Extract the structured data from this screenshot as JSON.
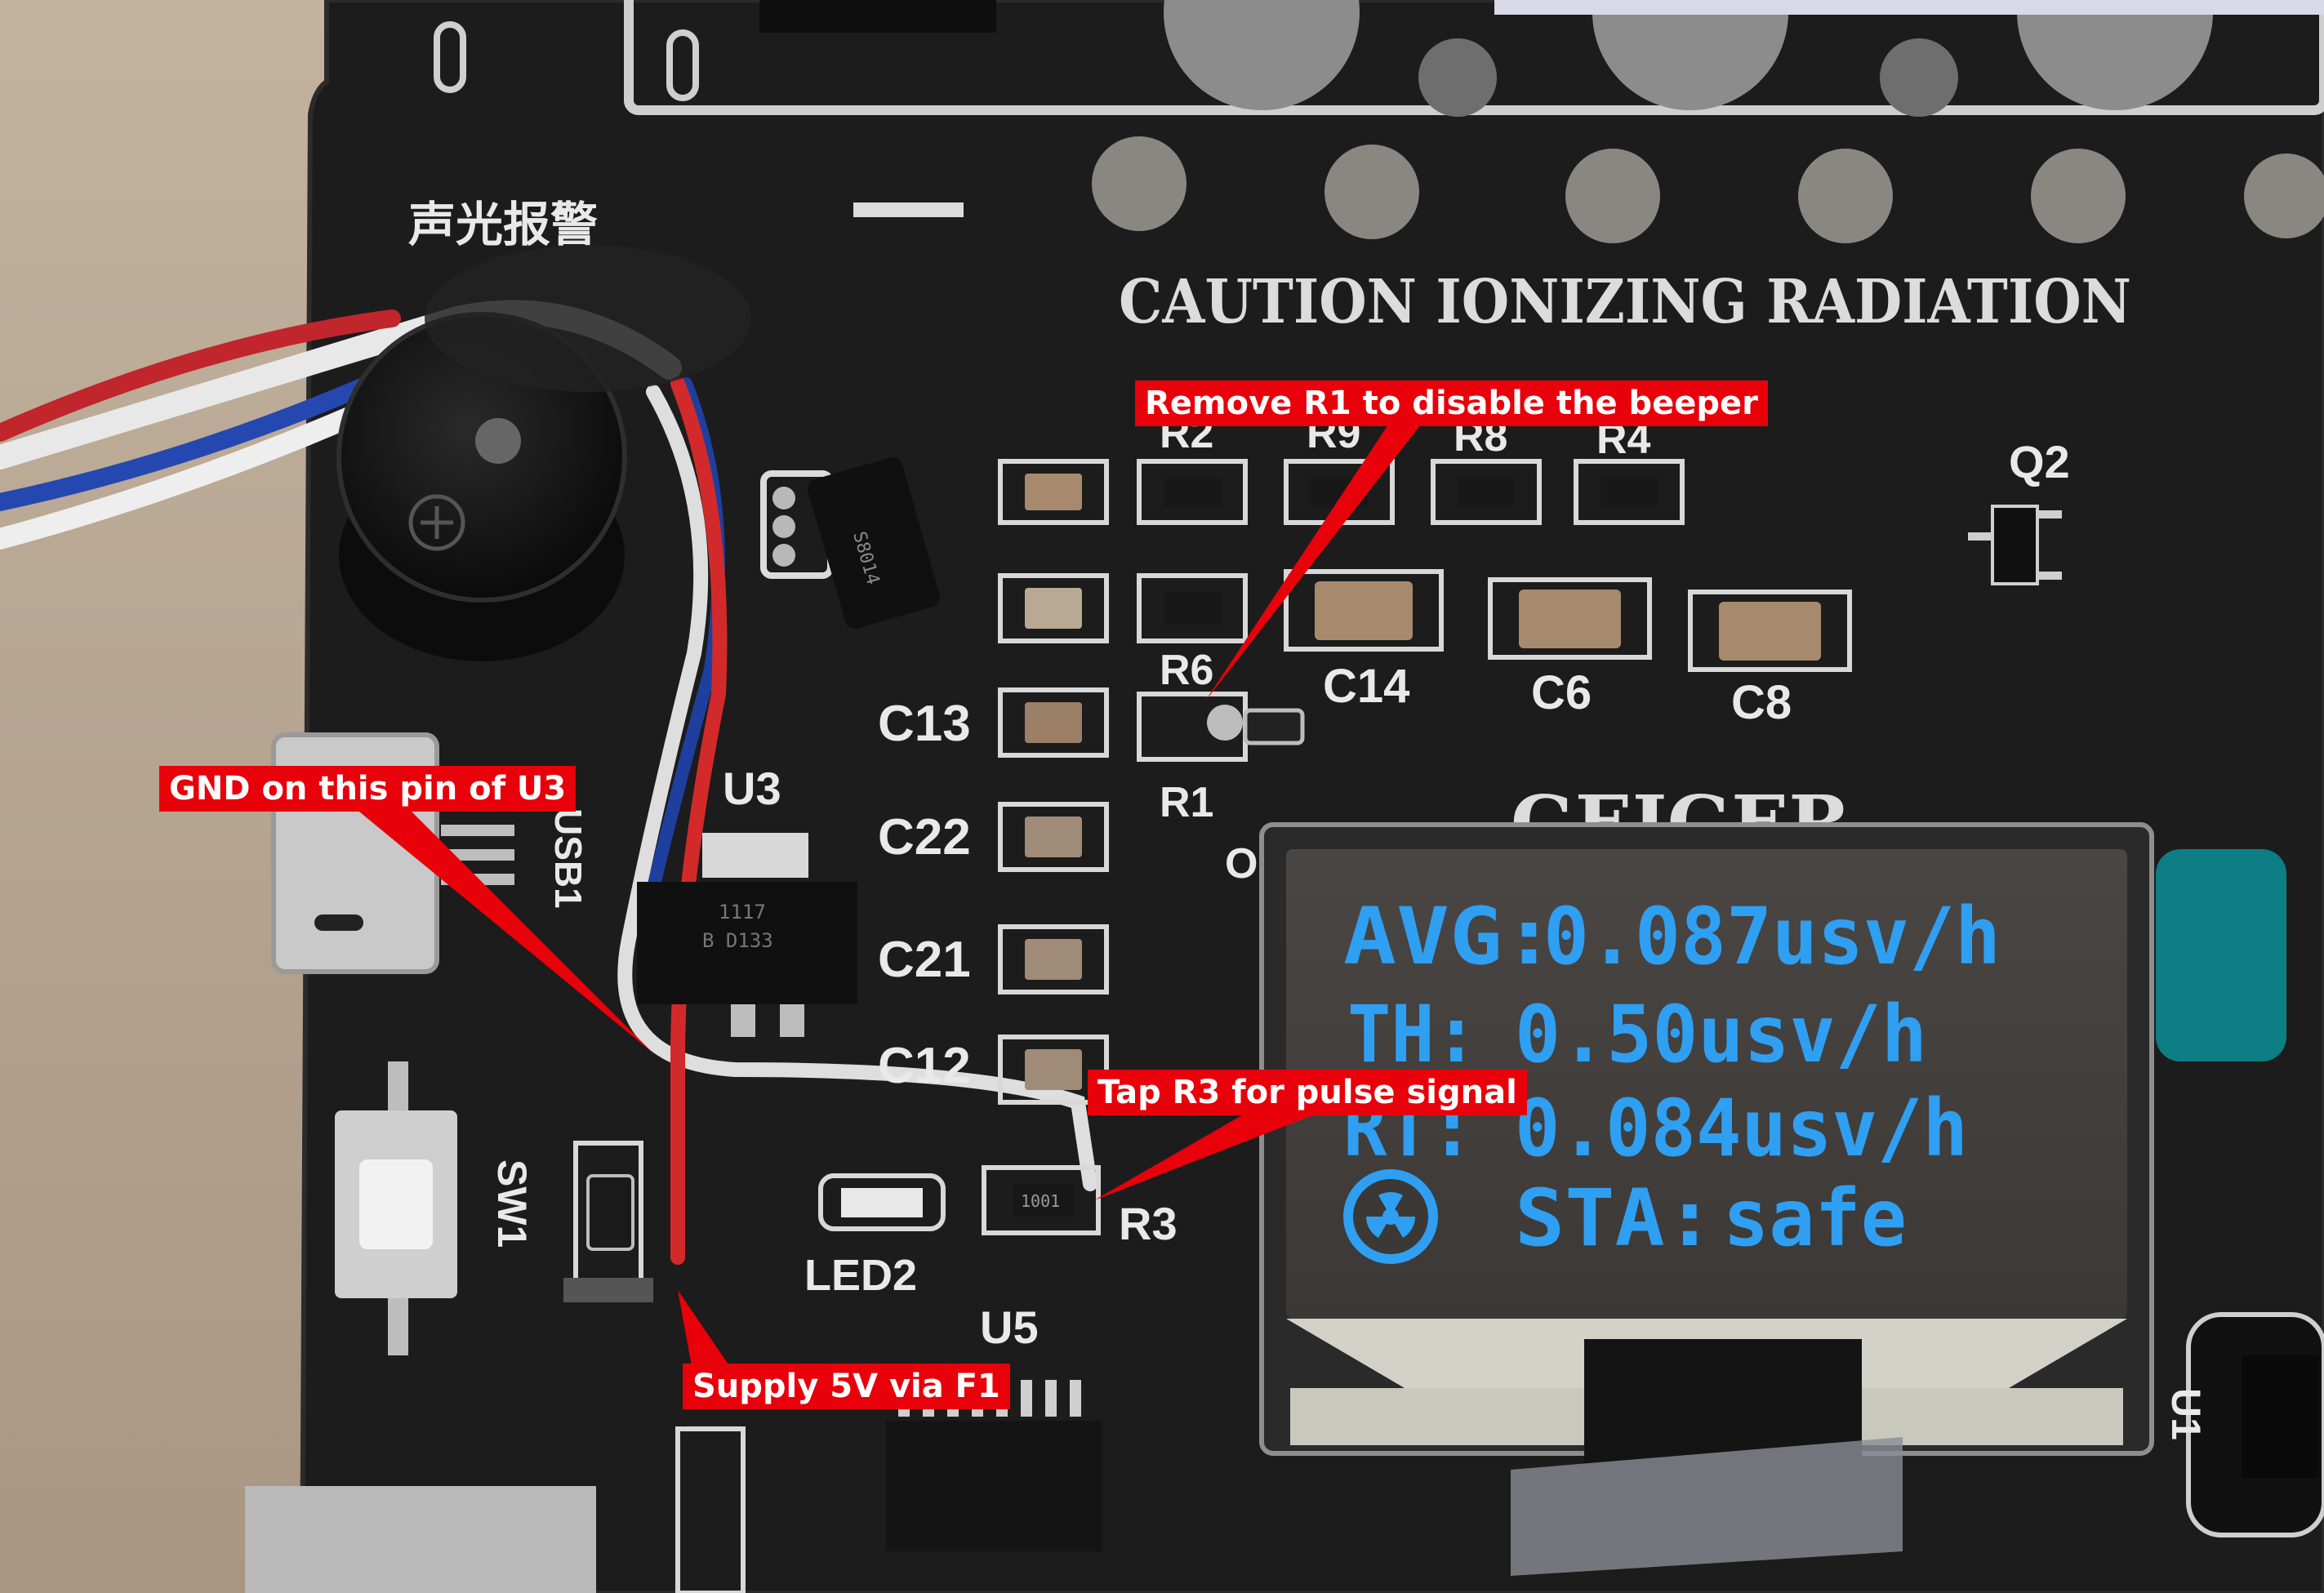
{
  "board": {
    "caution_text": "CAUTION IONIZING RADIATION",
    "geiger_text": "GEIGER",
    "chinese_label": "声光报警",
    "silkscreen_labels": [
      "R2",
      "R9",
      "R8",
      "R4",
      "Q2",
      "R6",
      "C14",
      "C6",
      "C8",
      "C13",
      "R1",
      "C22",
      "C21",
      "C12",
      "R3",
      "U3",
      "USB1",
      "SW1",
      "LED2",
      "U5",
      "U1",
      "OLED"
    ],
    "chip_markings": {
      "u3_line1": "1117",
      "u3_line2": "B D133",
      "r3_code": "1001",
      "transistor": "S8014"
    }
  },
  "oled": {
    "avg_label": "AVG:",
    "avg_value": "0.087usv/h",
    "th_label": "TH:",
    "th_value": "0.50usv/h",
    "rt_label": "RT:",
    "rt_value": "0.084usv/h",
    "sta_label": "STA:",
    "sta_value": "safe",
    "radiation_icon": "radiation-icon",
    "text_color": "#2f9ff2"
  },
  "callouts": {
    "r1_note": "Remove R1 to disable the beeper",
    "gnd_note": "GND on this pin of U3",
    "r3_note": "Tap R3 for pulse signal",
    "supply_note": "Supply 5V via F1",
    "callout_color": "#e8000a"
  }
}
